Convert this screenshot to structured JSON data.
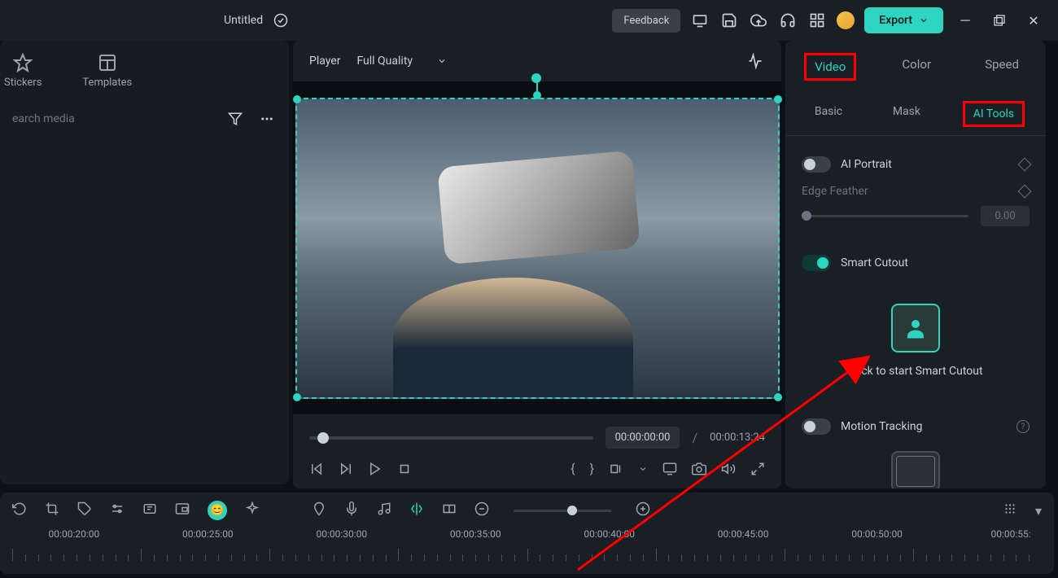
{
  "titlebar": {
    "title": "Untitled",
    "feedback_label": "Feedback",
    "export_label": "Export"
  },
  "sidebar": {
    "tabs": [
      {
        "label": "Stickers"
      },
      {
        "label": "Templates"
      }
    ],
    "search_placeholder": "earch media"
  },
  "player": {
    "label": "Player",
    "quality": "Full Quality",
    "time_current": "00:00:00:00",
    "time_separator": "/",
    "time_total": "00:00:13:24"
  },
  "right_panel": {
    "top_tabs": [
      {
        "label": "Video",
        "active": true
      },
      {
        "label": "Color",
        "active": false
      },
      {
        "label": "Speed",
        "active": false
      }
    ],
    "sub_tabs": [
      {
        "label": "Basic",
        "active": false
      },
      {
        "label": "Mask",
        "active": false
      },
      {
        "label": "AI Tools",
        "active": true
      }
    ],
    "ai_portrait_label": "AI Portrait",
    "edge_feather_label": "Edge Feather",
    "edge_feather_value": "0.00",
    "smart_cutout_label": "Smart Cutout",
    "smart_cutout_cta": "Click to start Smart Cutout",
    "motion_tracking_label": "Motion Tracking"
  },
  "timeline": {
    "marks": [
      "00:00:20:00",
      "00:00:25:00",
      "00:00:30:00",
      "00:00:35:00",
      "00:00:40:00",
      "00:00:45:00",
      "00:00:50:00",
      "00:00:55:"
    ]
  },
  "colors": {
    "accent": "#2dd4bf",
    "annotation": "#ff0000"
  }
}
